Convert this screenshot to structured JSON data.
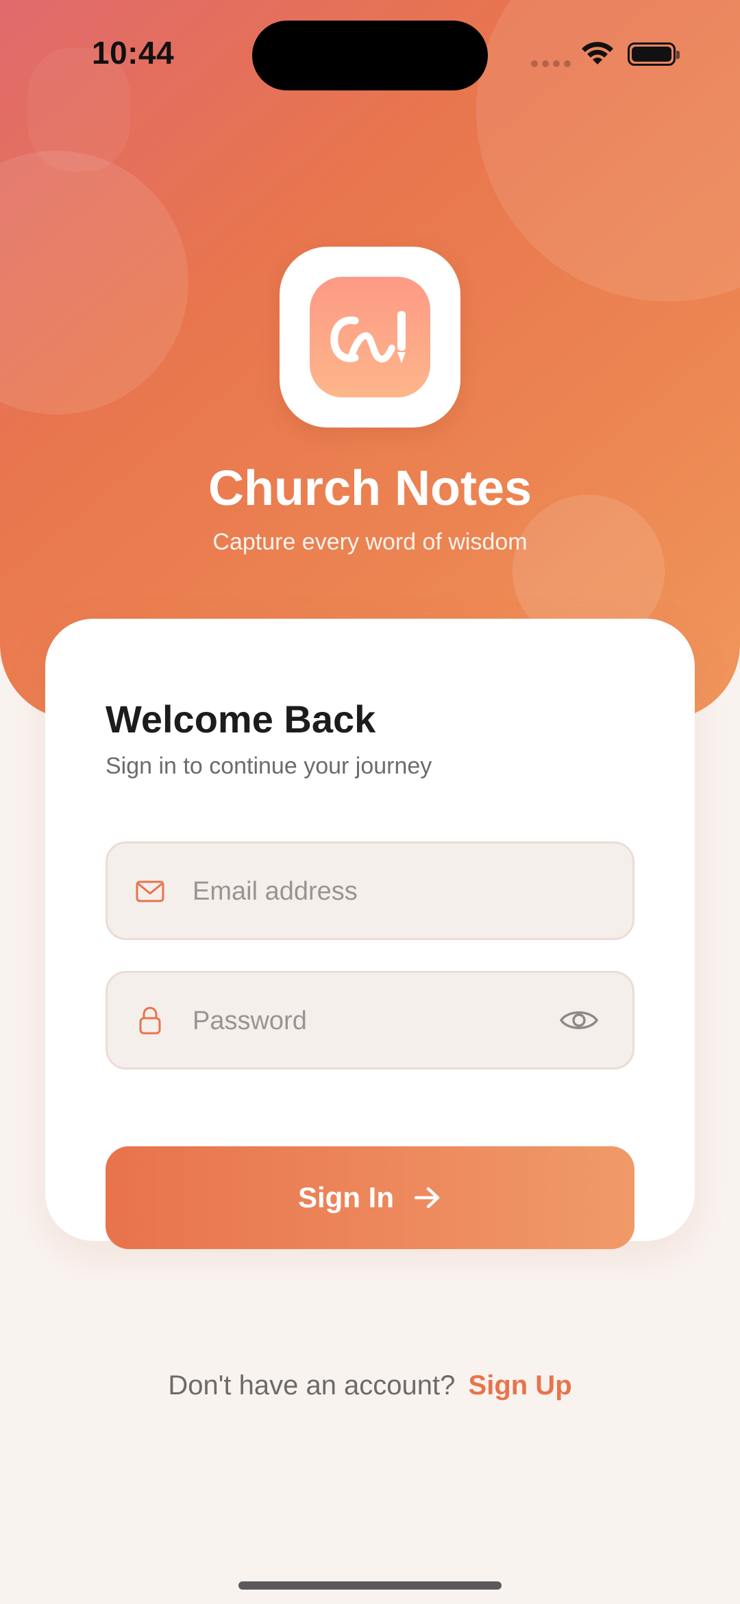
{
  "status_bar": {
    "time": "10:44"
  },
  "app": {
    "name": "Church Notes",
    "tagline": "Capture every word of wisdom"
  },
  "login_card": {
    "title": "Welcome Back",
    "subtitle": "Sign in to continue your journey",
    "email": {
      "placeholder": "Email address",
      "value": "",
      "icon": "mail-icon"
    },
    "password": {
      "placeholder": "Password",
      "value": "",
      "icon": "lock-icon",
      "toggle_icon": "eye-icon"
    },
    "submit_label": "Sign In"
  },
  "footer": {
    "prompt": "Don't have an account?",
    "link_label": "Sign Up"
  },
  "colors": {
    "accent": "#e8734c",
    "hero_start": "#e06a6c",
    "hero_end": "#f0975c",
    "background": "#f9f3ef"
  }
}
